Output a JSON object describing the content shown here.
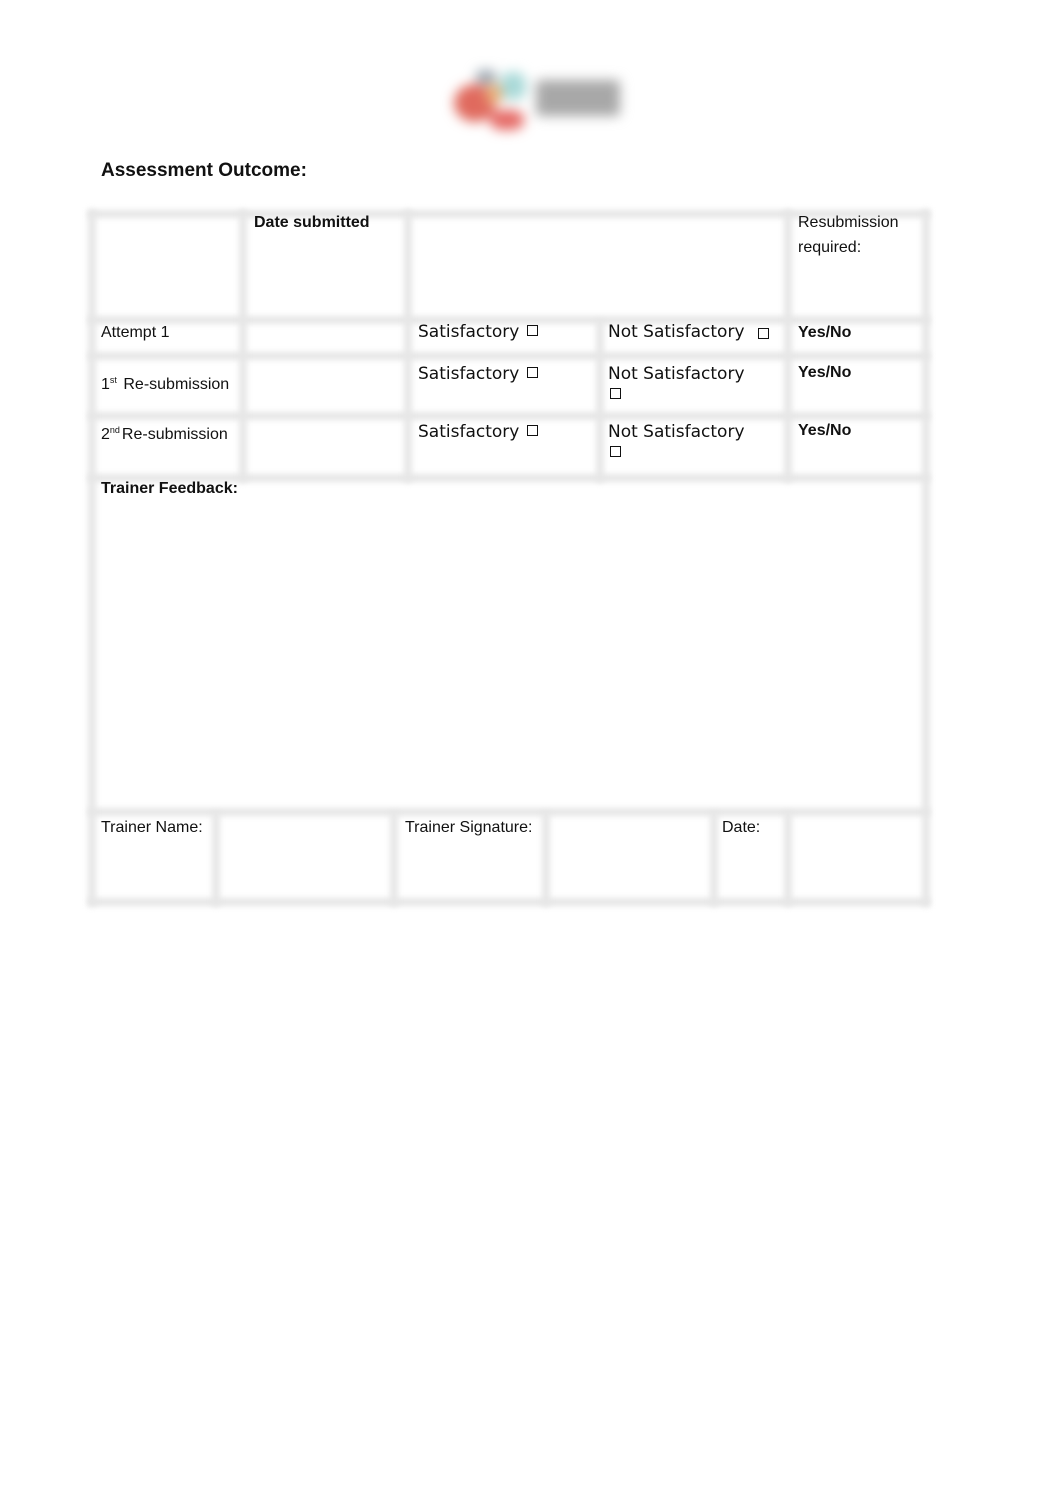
{
  "logo": {
    "name": "organization-logo"
  },
  "heading": "Assessment Outcome:",
  "table": {
    "header": {
      "date_submitted": "Date submitted",
      "resubmission_line1": "Resubmission",
      "resubmission_line2": "required:"
    },
    "rows": [
      {
        "label": "Attempt 1",
        "ordinal": "",
        "ordinal_suffix": "",
        "satisfactory": "Satisfactory",
        "not_satisfactory": "Not Satisfactory",
        "resubmit": "Yes/No",
        "satisfactory_checked": false,
        "not_satisfactory_checked": false
      },
      {
        "label": "Re-submission",
        "ordinal": "1",
        "ordinal_suffix": "st",
        "satisfactory": "Satisfactory",
        "not_satisfactory": "Not Satisfactory",
        "resubmit": "Yes/No",
        "satisfactory_checked": false,
        "not_satisfactory_checked": false
      },
      {
        "label": "Re-submission",
        "ordinal": "2",
        "ordinal_suffix": "nd",
        "satisfactory": "Satisfactory",
        "not_satisfactory": "Not Satisfactory",
        "resubmit": "Yes/No",
        "satisfactory_checked": false,
        "not_satisfactory_checked": false
      }
    ],
    "feedback_label": "Trainer Feedback:",
    "feedback_value": "",
    "footer": {
      "trainer_name_label": "Trainer Name:",
      "trainer_name_value": "",
      "trainer_signature_label": "Trainer Signature:",
      "trainer_signature_value": "",
      "date_label": "Date:",
      "date_value": ""
    }
  }
}
